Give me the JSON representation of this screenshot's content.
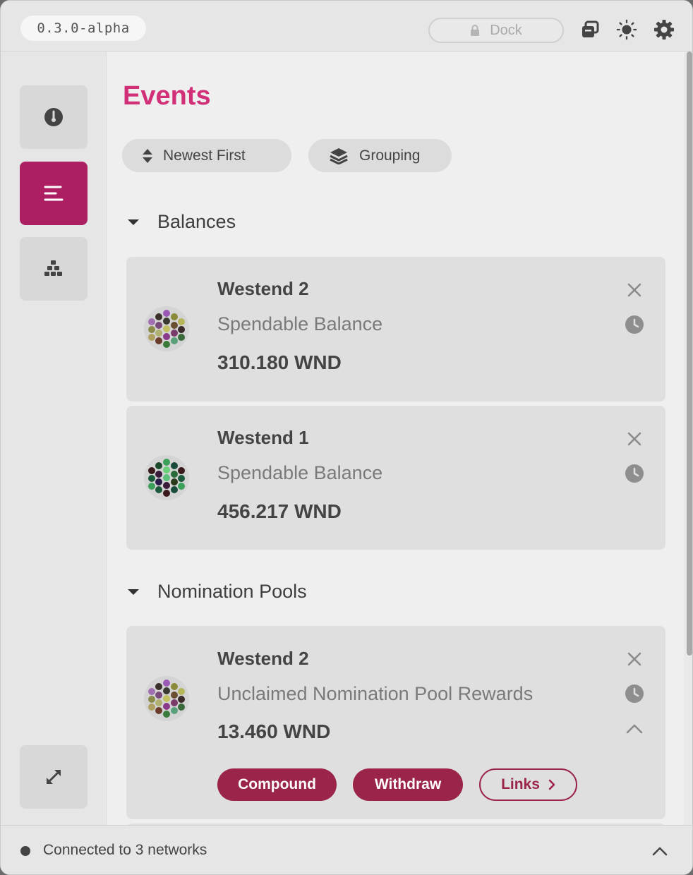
{
  "header": {
    "version": "0.3.0-alpha",
    "dock_label": "Dock",
    "icons": [
      "copy-windows-icon",
      "sun-icon",
      "gear-icon"
    ]
  },
  "sidebar": {
    "items": [
      {
        "name": "overview",
        "icon": "gauge-icon",
        "active": false
      },
      {
        "name": "events",
        "icon": "list-icon",
        "active": true
      },
      {
        "name": "accounts",
        "icon": "stack-icon",
        "active": false
      }
    ],
    "bottom_icon": "expand-icon"
  },
  "main": {
    "title": "Events",
    "sort_label": "Newest First",
    "group_label": "Grouping",
    "sections": [
      {
        "title": "Balances",
        "cards": [
          {
            "account": "Westend 2",
            "description": "Spendable Balance",
            "value": "310.180 WND"
          },
          {
            "account": "Westend 1",
            "description": "Spendable Balance",
            "value": "456.217 WND"
          }
        ]
      },
      {
        "title": "Nomination Pools",
        "cards": [
          {
            "account": "Westend 2",
            "description": "Unclaimed Nomination Pool Rewards",
            "value": "13.460 WND",
            "actions": {
              "compound": "Compound",
              "withdraw": "Withdraw",
              "links": "Links"
            }
          }
        ]
      }
    ]
  },
  "footer": {
    "status": "Connected to 3 networks"
  },
  "colors": {
    "accent": "#d13079",
    "sidebar_active": "#ad1f63",
    "action_button": "#9b2449"
  }
}
